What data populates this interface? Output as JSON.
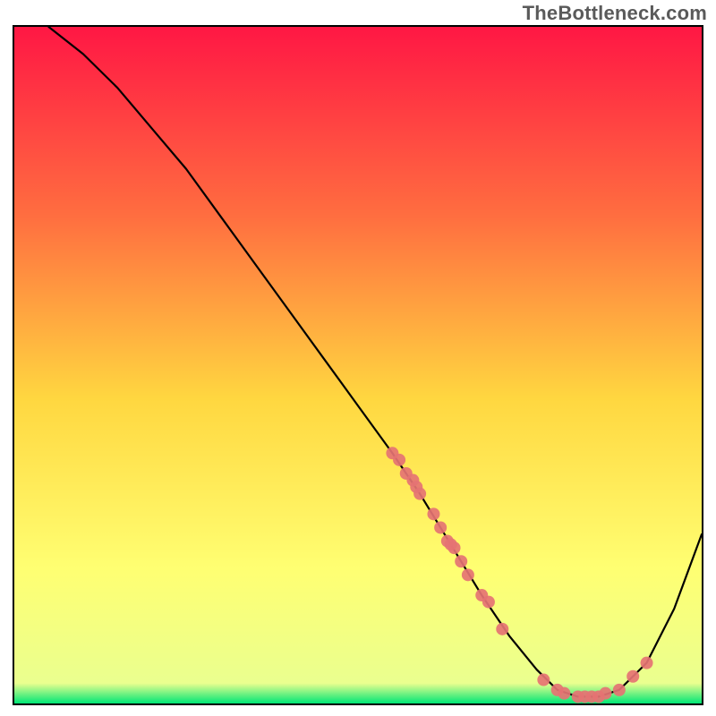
{
  "watermark": "TheBottleneck.com",
  "chart_data": {
    "type": "line",
    "title": "",
    "xlabel": "",
    "ylabel": "",
    "xlim": [
      0,
      100
    ],
    "ylim": [
      0,
      100
    ],
    "grid": false,
    "legend": false,
    "curve": {
      "name": "bottleneck-curve",
      "x": [
        5,
        10,
        15,
        20,
        25,
        30,
        35,
        40,
        45,
        50,
        55,
        59,
        62,
        65,
        68,
        72,
        76,
        79,
        82,
        85,
        88,
        92,
        96,
        100
      ],
      "y": [
        100,
        96,
        91,
        85,
        79,
        72,
        65,
        58,
        51,
        44,
        37,
        31,
        26,
        21,
        16,
        10,
        5,
        2,
        1,
        1,
        2,
        6,
        14,
        25
      ]
    },
    "scatter": {
      "name": "highlight-points",
      "color": "#e57373",
      "x": [
        55,
        56,
        57,
        58,
        58.5,
        59,
        61,
        62,
        63,
        63.5,
        64,
        65,
        66,
        68,
        69,
        71,
        77,
        79,
        80,
        82,
        83,
        84,
        85,
        86,
        88,
        90,
        92
      ],
      "y": [
        37,
        36,
        34,
        33,
        32,
        31,
        28,
        26,
        24,
        23.5,
        23,
        21,
        19,
        16,
        15,
        11,
        3.5,
        2,
        1.5,
        1,
        1,
        1,
        1,
        1.5,
        2,
        4,
        6
      ]
    },
    "background_gradient": {
      "top": "#ff1744",
      "mid_upper": "#ff6e40",
      "mid": "#ffd740",
      "mid_lower": "#ffff72",
      "bottom": "#00e676"
    }
  }
}
